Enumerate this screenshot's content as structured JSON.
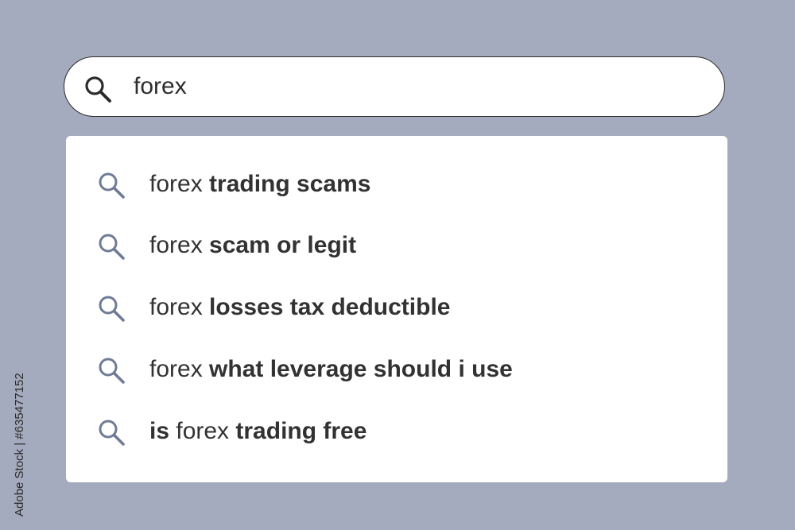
{
  "search": {
    "query": "forex",
    "icon": "search-icon"
  },
  "suggestions": [
    {
      "parts": [
        {
          "text": "forex ",
          "bold": false
        },
        {
          "text": "trading scams",
          "bold": true
        }
      ]
    },
    {
      "parts": [
        {
          "text": "forex ",
          "bold": false
        },
        {
          "text": "scam or legit",
          "bold": true
        }
      ]
    },
    {
      "parts": [
        {
          "text": "forex ",
          "bold": false
        },
        {
          "text": "losses tax deductible",
          "bold": true
        }
      ]
    },
    {
      "parts": [
        {
          "text": "forex ",
          "bold": false
        },
        {
          "text": "what leverage should i use",
          "bold": true
        }
      ]
    },
    {
      "parts": [
        {
          "text": "is ",
          "bold": true
        },
        {
          "text": "forex ",
          "bold": false
        },
        {
          "text": "trading free",
          "bold": true
        }
      ]
    }
  ],
  "watermark": {
    "stock_id": "Adobe Stock | #635477152"
  },
  "colors": {
    "background": "#a5abbe",
    "search_icon": "#2b2b2b",
    "suggestion_icon": "#6f7b95",
    "text": "#323232"
  }
}
